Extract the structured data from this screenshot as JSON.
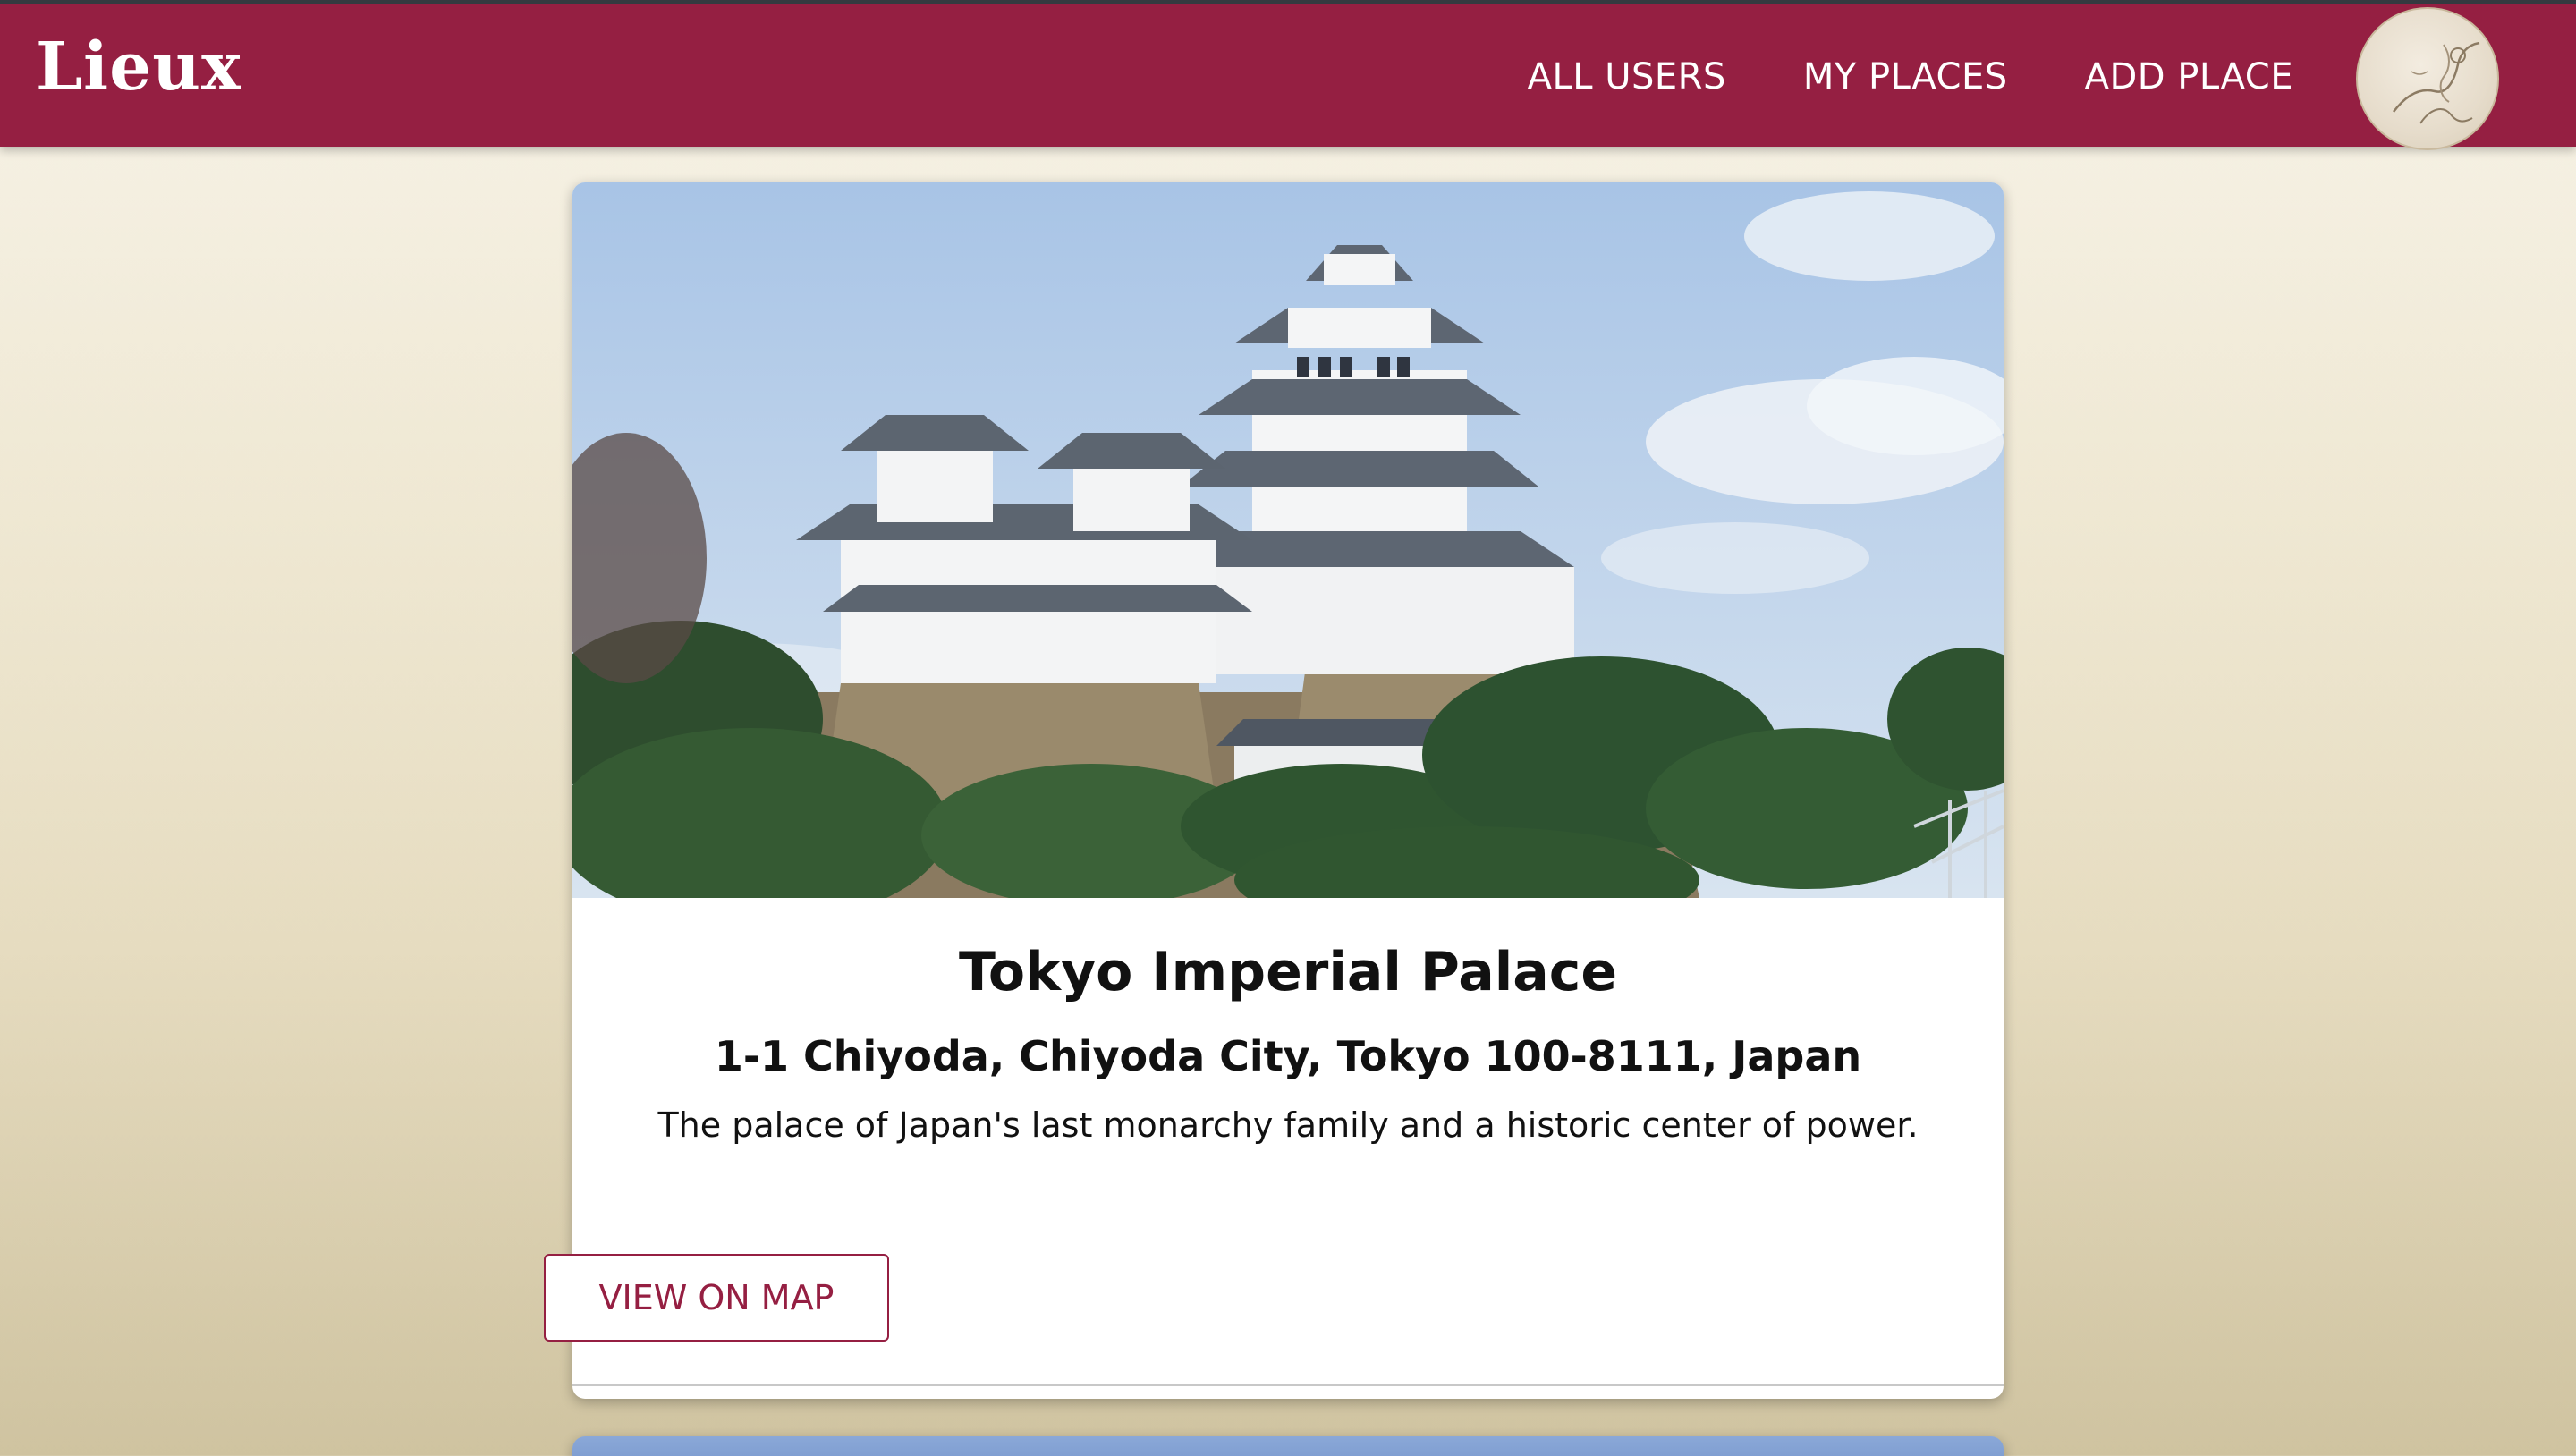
{
  "header": {
    "logo": "Lieux",
    "nav": [
      "ALL USERS",
      "MY PLACES",
      "ADD PLACE"
    ]
  },
  "place": {
    "title": "Tokyo Imperial Palace",
    "address": "1-1 Chiyoda, Chiyoda City, Tokyo 100-8111, Japan",
    "description": "The palace of Japan's last monarchy family and a historic center of power.",
    "button_label": "VIEW ON MAP"
  },
  "colors": {
    "brand": "#951f42",
    "header_border": "#343a40"
  },
  "icons": {
    "avatar": "user-avatar-sketch"
  }
}
